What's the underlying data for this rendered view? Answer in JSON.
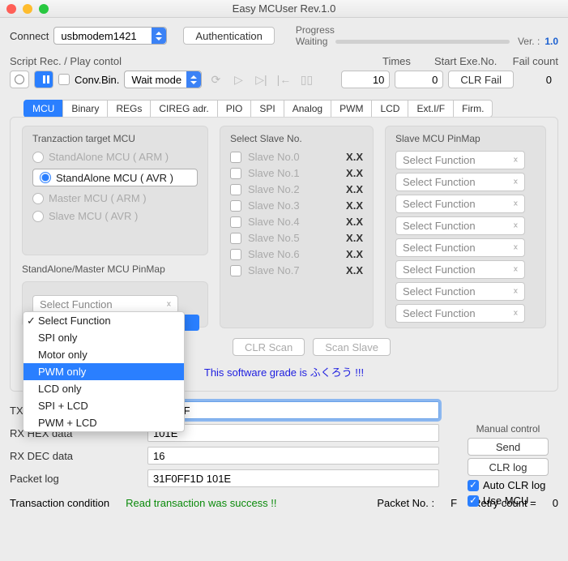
{
  "window": {
    "title": "Easy MCUser Rev.1.0"
  },
  "header": {
    "connect_label": "Connect",
    "port": "usbmodem1421",
    "auth_label": "Authentication",
    "progress_label": "Progress",
    "status": "Waiting",
    "ver_label": "Ver. :",
    "ver": "1.0"
  },
  "rec": {
    "title": "Script Rec. / Play contol",
    "convbin": "Conv.Bin.",
    "mode": "Wait mode",
    "times_label": "Times",
    "times": "10",
    "start_label": "Start Exe.No.",
    "start": "0",
    "clr_label": "CLR Fail",
    "fail_label": "Fail count",
    "fail": "0"
  },
  "tabs": [
    "MCU",
    "Binary",
    "REGs",
    "CIREG adr.",
    "PIO",
    "SPI",
    "Analog",
    "PWM",
    "LCD",
    "Ext.I/F",
    "Firm."
  ],
  "mcu": {
    "target_title": "Tranzaction target MCU",
    "targets": [
      "StandAlone MCU ( ARM )",
      "StandAlone MCU ( AVR )",
      "Master MCU ( ARM )",
      "Slave MCU ( AVR )"
    ],
    "selected_target": 1,
    "pinmap_title": "StandAlone/Master MCU PinMap",
    "pinmap_sel": "Select Function",
    "dropdown": [
      "Select Function",
      "SPI only",
      "Motor only",
      "PWM only",
      "LCD only",
      "SPI + LCD",
      "PWM + LCD"
    ],
    "dropdown_checked": 0,
    "dropdown_hl": 3,
    "slave_title": "Select Slave No.",
    "slaves": [
      {
        "label": "Slave No.0",
        "v": "X.X"
      },
      {
        "label": "Slave No.1",
        "v": "X.X"
      },
      {
        "label": "Slave No.2",
        "v": "X.X"
      },
      {
        "label": "Slave No.3",
        "v": "X.X"
      },
      {
        "label": "Slave No.4",
        "v": "X.X"
      },
      {
        "label": "Slave No.5",
        "v": "X.X"
      },
      {
        "label": "Slave No.6",
        "v": "X.X"
      },
      {
        "label": "Slave No.7",
        "v": "X.X"
      }
    ],
    "slavemap_title": "Slave MCU PinMap",
    "slavemap_sel": "Select Function",
    "clr_scan": "CLR Scan",
    "scan_slave": "Scan Slave",
    "grade": "This software grade is ふくろう !!!"
  },
  "data": {
    "txhex_label": "TX HEX data",
    "txhex": "31F0FF",
    "rxhex_label": "RX HEX data",
    "rxhex": "101E",
    "rxdec_label": "RX DEC data",
    "rxdec": "16",
    "pkt_label": "Packet log",
    "pkt": "31F0FF1D 101E"
  },
  "manual": {
    "title": "Manual control",
    "send": "Send",
    "clr": "CLR log",
    "auto": "Auto CLR log",
    "use": "Use MCU"
  },
  "bottom": {
    "cond_label": "Transaction condition",
    "cond": "Read transaction was success !!",
    "pktno_label": "Packet No. :",
    "pktno": "F",
    "retry_label": "Retry count  =",
    "retry": "0"
  }
}
